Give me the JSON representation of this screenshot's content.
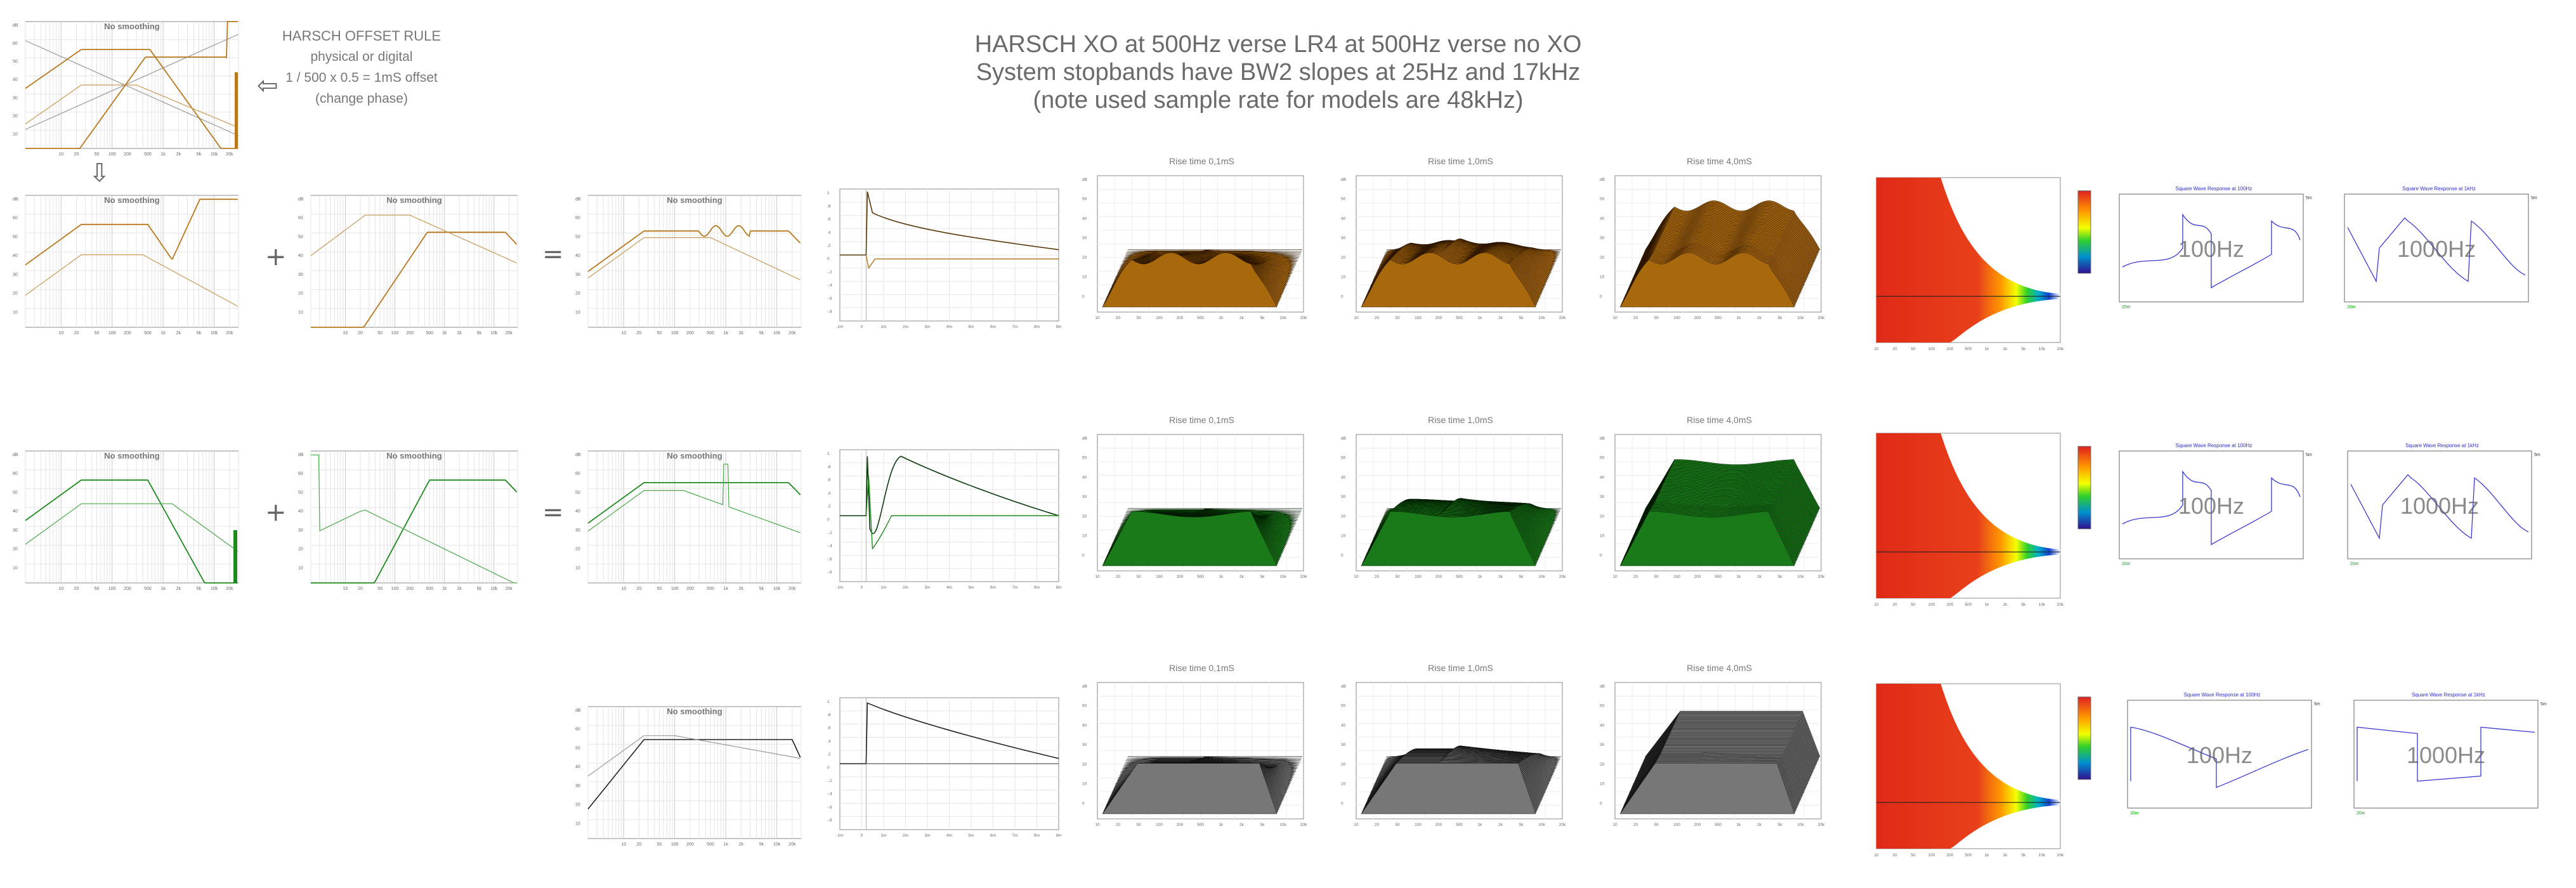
{
  "title": {
    "line1": "HARSCH XO at 500Hz verse LR4 at 500Hz verse no XO",
    "line2": "System stopbands have BW2 slopes at 25Hz and 17kHz",
    "line3": "(note used sample rate for models are 48kHz)"
  },
  "offset_rule": {
    "line1": "HARSCH OFFSET RULE",
    "line2": "physical or digital",
    "line3": "1 / 500 x 0.5 = 1mS offset",
    "line4": "(change phase)"
  },
  "operators": {
    "plus": "+",
    "equals": "=",
    "arrow_left": "⇦",
    "arrow_down": "⇩"
  },
  "colors": {
    "harsch": "#b8781e",
    "harsch_dark": "#5a3a0a",
    "lr4": "#1e8a1e",
    "lr4_dark": "#0a3a0a",
    "noxo": "#777777",
    "noxo_dark": "#222222",
    "square": "#3a3ad0"
  },
  "freq_ticks": [
    "2",
    "3",
    "4",
    "5",
    "6",
    "8",
    "10",
    "",
    "20",
    "30",
    "40",
    "50",
    "70",
    "100Hz",
    "",
    "200",
    "300",
    "500",
    "700",
    "1k",
    "",
    "2k",
    "3k",
    "5k",
    "7k",
    "10k",
    "",
    "20k",
    "30k",
    "50kHz"
  ],
  "chart_data": [
    {
      "type": "line",
      "name": "harsch-drivers-phase",
      "title": "No smoothing",
      "xscale": "log",
      "xlim": [
        2,
        30000
      ],
      "ylim": [
        0,
        70
      ],
      "series": [
        {
          "name": "woofer",
          "values": [
            [
              2,
              0
            ],
            [
              10,
              20
            ],
            [
              25,
              45
            ],
            [
              40,
              50
            ],
            [
              300,
              50
            ],
            [
              600,
              40
            ],
            [
              1500,
              0
            ]
          ]
        },
        {
          "name": "tweeter",
          "values": [
            [
              2000,
              0
            ],
            [
              6000,
              50
            ],
            [
              17000,
              45
            ],
            [
              25000,
              20
            ]
          ]
        }
      ]
    },
    {
      "type": "line",
      "name": "harsch-woofer",
      "title": "No smoothing",
      "xscale": "log",
      "xlim": [
        2,
        30000
      ],
      "ylim": [
        0,
        70
      ]
    },
    {
      "type": "line",
      "name": "harsch-tweeter",
      "title": "No smoothing",
      "xscale": "log",
      "xlim": [
        2,
        30000
      ],
      "ylim": [
        0,
        70
      ]
    },
    {
      "type": "line",
      "name": "harsch-sum",
      "title": "No smoothing",
      "xscale": "log",
      "xlim": [
        2,
        30000
      ],
      "ylim": [
        0,
        70
      ]
    },
    {
      "type": "line",
      "name": "lr4-woofer",
      "title": "No smoothing",
      "xscale": "log",
      "xlim": [
        2,
        30000
      ],
      "ylim": [
        0,
        70
      ]
    },
    {
      "type": "line",
      "name": "lr4-tweeter",
      "title": "No smoothing",
      "xscale": "log",
      "xlim": [
        2,
        30000
      ],
      "ylim": [
        0,
        70
      ]
    },
    {
      "type": "line",
      "name": "lr4-sum",
      "title": "No smoothing",
      "xscale": "log",
      "xlim": [
        2,
        30000
      ],
      "ylim": [
        0,
        70
      ]
    },
    {
      "type": "line",
      "name": "noxo-sum",
      "title": "No smoothing",
      "xscale": "log",
      "xlim": [
        2,
        30000
      ],
      "ylim": [
        0,
        70
      ]
    },
    {
      "type": "line",
      "name": "step-responses",
      "ylim": [
        -1,
        1
      ]
    },
    {
      "type": "area",
      "name": "waterfall",
      "panels": [
        {
          "label": "Rise time 0,1mS"
        },
        {
          "label": "Rise time 1,0mS"
        },
        {
          "label": "Rise time 4,0mS"
        },
        {
          "label": "Rise time 0,1mS"
        },
        {
          "label": "Rise time 1,0mS"
        },
        {
          "label": "Rise time 4,0mS"
        },
        {
          "label": "Rise time 0,1mS"
        },
        {
          "label": "Rise time 1,0mS"
        },
        {
          "label": "Rise time 4,0mS"
        }
      ]
    },
    {
      "type": "heatmap",
      "name": "spectrogram"
    },
    {
      "type": "line",
      "name": "square-wave",
      "panels": [
        {
          "title": "Square Wave Response at 100Hz",
          "label": "100Hz"
        },
        {
          "title": "Square Wave Response at 1kHz",
          "label": "1000Hz"
        }
      ]
    }
  ]
}
